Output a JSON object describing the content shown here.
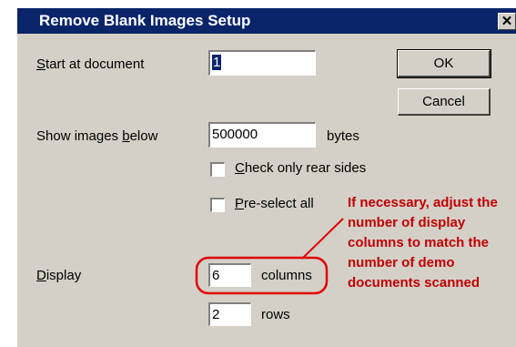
{
  "dialog": {
    "title": "Remove Blank Images Setup",
    "close_glyph": "✕",
    "start_label_key": "S",
    "start_label_rest": "tart at document",
    "start_value": "1",
    "show_label_pre": "Show images ",
    "show_label_key": "b",
    "show_label_rest": "elow",
    "show_value": "500000",
    "bytes_label": "bytes",
    "check_rear_key": "C",
    "check_rear_rest": "heck only rear sides",
    "preselect_key": "P",
    "preselect_rest": "re-select all",
    "display_key": "D",
    "display_rest": "isplay",
    "columns_value": "6",
    "columns_label": "columns",
    "rows_value": "2",
    "rows_label": "rows",
    "ok_label": "OK",
    "cancel_label": "Cancel"
  },
  "annotation": {
    "text": "If necessary, adjust the number of display columns to match the number of demo documents scanned",
    "color": "#c00000"
  },
  "colors": {
    "titlebar": "#0a246a",
    "dialog_bg": "#d4d0c8"
  }
}
